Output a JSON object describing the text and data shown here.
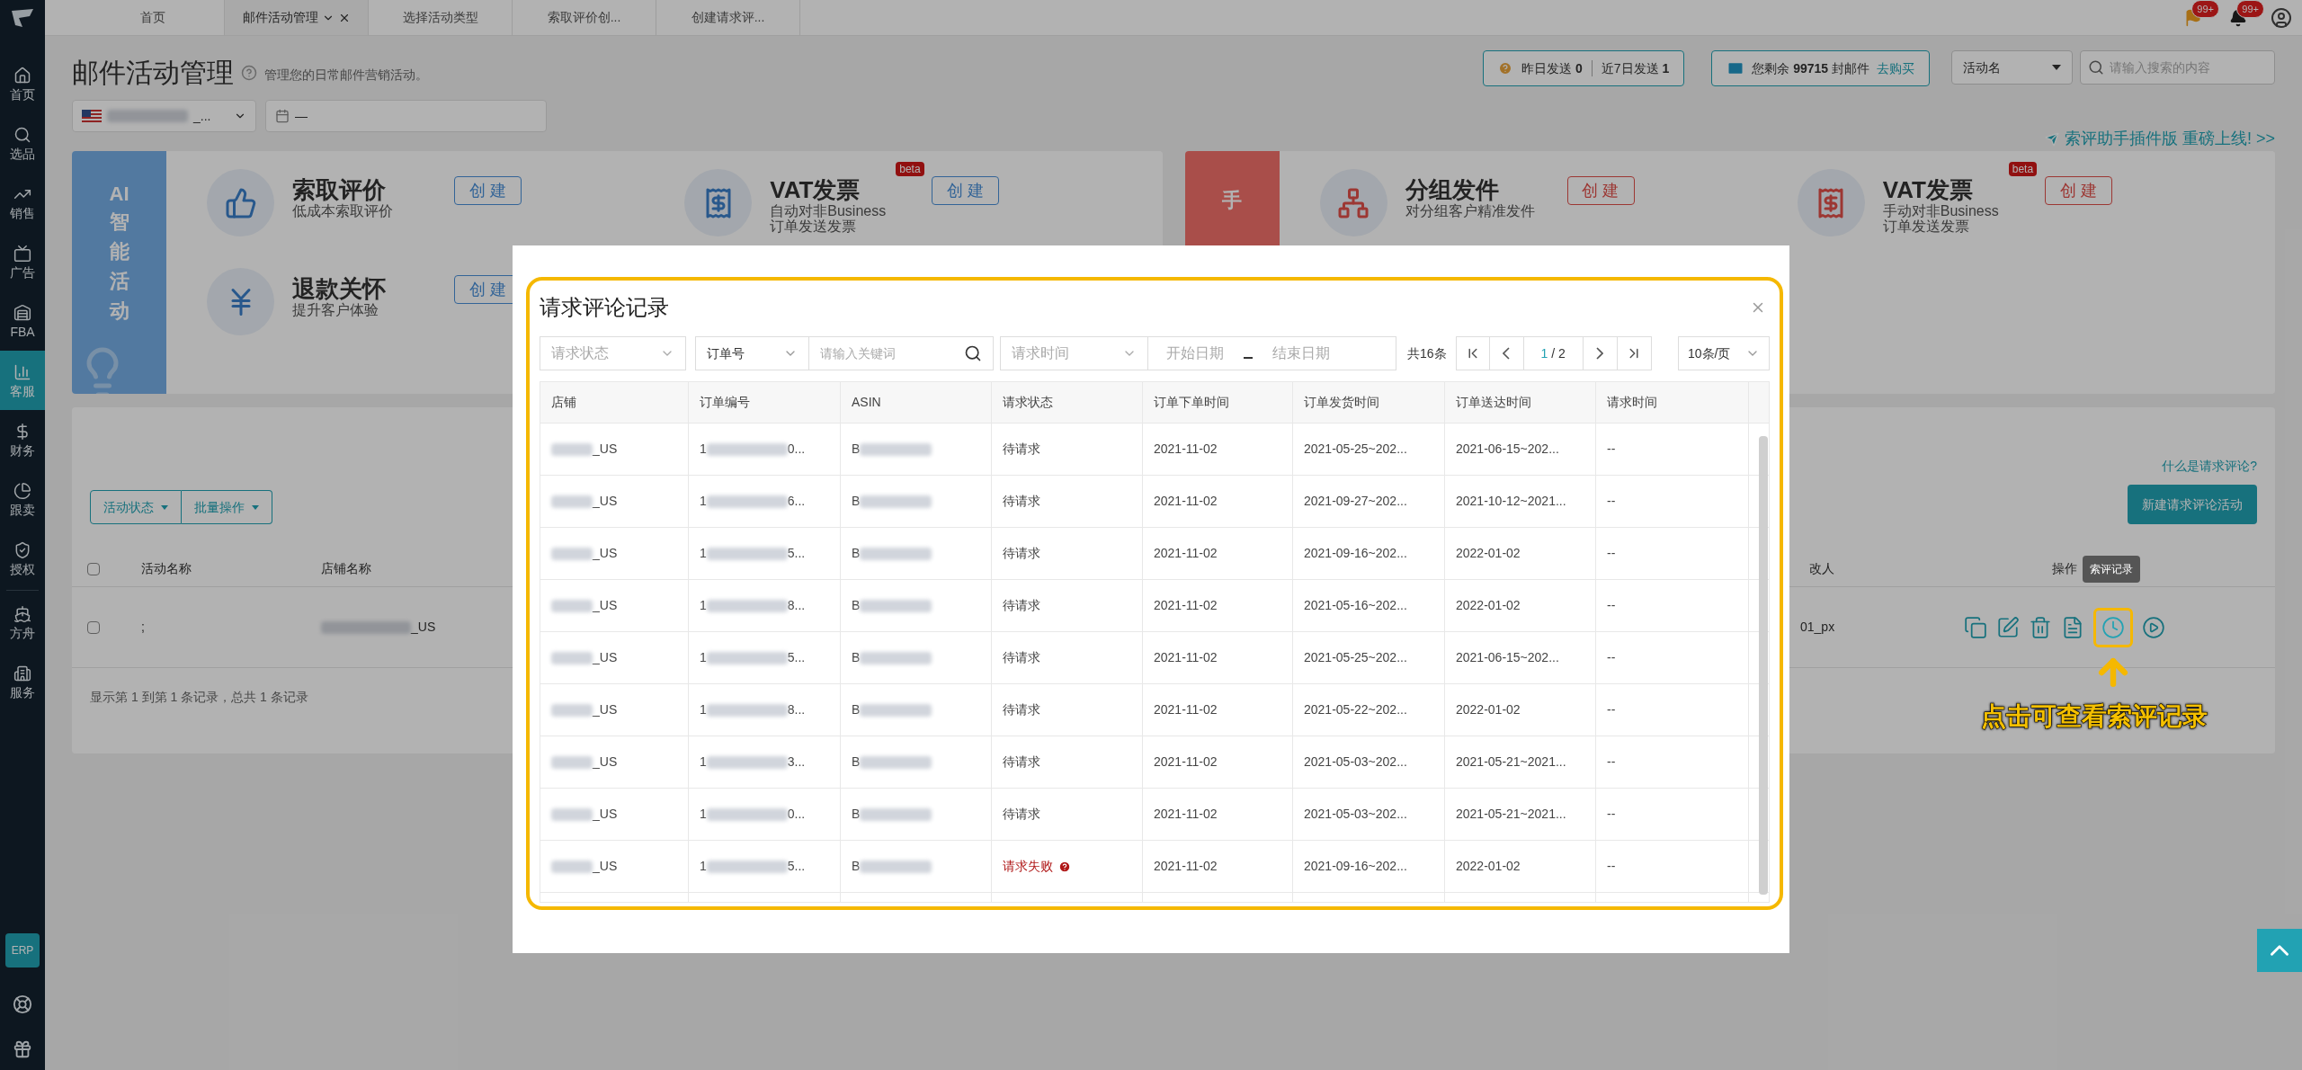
{
  "top_tabs": [
    {
      "label": "首页",
      "selected": false,
      "closable": false
    },
    {
      "label": "邮件活动管理",
      "selected": true,
      "closable": true
    },
    {
      "label": "选择活动类型",
      "selected": false,
      "closable": false
    },
    {
      "label": "索取评价创...",
      "selected": false,
      "closable": false
    },
    {
      "label": "创建请求评...",
      "selected": false,
      "closable": false
    }
  ],
  "notifications": [
    {
      "badge": "99+"
    },
    {
      "badge": "99+"
    }
  ],
  "sidebar": {
    "items": [
      {
        "label": "首页",
        "selected": false
      },
      {
        "label": "选品",
        "selected": false
      },
      {
        "label": "销售",
        "selected": false
      },
      {
        "label": "广告",
        "selected": false
      },
      {
        "label": "FBA",
        "selected": false
      },
      {
        "label": "客服",
        "selected": true
      },
      {
        "label": "财务",
        "selected": false
      },
      {
        "label": "跟卖",
        "selected": false
      },
      {
        "label": "授权",
        "selected": false
      },
      {
        "label": "方舟",
        "selected": false
      },
      {
        "label": "服务",
        "selected": false
      }
    ],
    "erp": "ERP"
  },
  "header": {
    "title": "邮件活动管理",
    "subtitle": "管理您的日常邮件营销活动。",
    "store_suffix": "_...",
    "date": "—",
    "sent_yesterday_label": "昨日发送",
    "sent_yesterday": "0",
    "sent_week_label": "近7日发送",
    "sent_week": "1",
    "remaining_prefix": "您剩余",
    "remaining": "99715",
    "remaining_suffix": "封邮件",
    "buy": "去购买",
    "search_type": "活动名",
    "search_placeholder": "请输入搜索的内容",
    "plugin_link": "索评助手插件版 重磅上线! >>"
  },
  "card_groups": [
    {
      "kind": "ai",
      "label_top": "AI",
      "label": "智能活动",
      "items": [
        {
          "title": "索取评价",
          "desc": [
            "低成本索取评价"
          ],
          "create": "创 建"
        },
        {
          "title": "VAT发票",
          "desc": [
            "自动对非Business",
            "订单发送发票"
          ],
          "beta": "beta",
          "create": "创 建"
        },
        {
          "title": "退款关怀",
          "desc": [
            "提升客户体验"
          ],
          "create": "创 建"
        }
      ]
    },
    {
      "kind": "manual",
      "label": "手",
      "items": [
        {
          "title": "分组发件",
          "desc": [
            "对分组客户精准发件"
          ],
          "create": "创 建"
        },
        {
          "title": "VAT发票",
          "desc": [
            "手动对非Business",
            "订单发送发票"
          ],
          "beta": "beta",
          "create": "创 建"
        }
      ]
    }
  ],
  "campaigns": {
    "status_button": "活动状态",
    "batch_button": "批量操作",
    "help_link": "什么是请求评论?",
    "new_button": "新建请求评论活动",
    "columns": [
      "活动名称",
      "店铺名称",
      "改人",
      "操作"
    ],
    "header_checked": false,
    "rows": [
      {
        "checked": false,
        "name": ";",
        "store_suffix": "_US",
        "modifier": "01_px"
      }
    ],
    "footer": "显示第 1 到第 1 条记录，总共 1 条记录",
    "tooltip": "索评记录",
    "annotation": "点击可查看索评记录"
  },
  "modal": {
    "title": "请求评论记录",
    "status_placeholder": "请求状态",
    "order_type": "订单号",
    "keyword_placeholder": "请输入关键词",
    "time_placeholder": "请求时间",
    "start_placeholder": "开始日期",
    "end_placeholder": "结束日期",
    "total": "共16条",
    "page": "1",
    "pages": "/ 2",
    "page_size": "10条/页",
    "columns": [
      "店铺",
      "订单编号",
      "ASIN",
      "请求状态",
      "订单下单时间",
      "订单发货时间",
      "订单送达时间",
      "请求时间"
    ],
    "rows": [
      {
        "store": "_US",
        "order_start": "1",
        "order_end": "0...",
        "asin_start": "B",
        "status": "待请求",
        "failed": false,
        "ordered": "2021-11-02",
        "shipped": "2021-05-25~202...",
        "delivered": "2021-06-15~202...",
        "requested": "--"
      },
      {
        "store": "_US",
        "order_start": "1",
        "order_end": "6...",
        "asin_start": "B",
        "status": "待请求",
        "failed": false,
        "ordered": "2021-11-02",
        "shipped": "2021-09-27~202...",
        "delivered": "2021-10-12~2021...",
        "requested": "--"
      },
      {
        "store": "_US",
        "order_start": "1",
        "order_end": "5...",
        "asin_start": "B",
        "status": "待请求",
        "failed": false,
        "ordered": "2021-11-02",
        "shipped": "2021-09-16~202...",
        "delivered": "2022-01-02",
        "requested": "--"
      },
      {
        "store": "_US",
        "order_start": "1",
        "order_end": "8...",
        "asin_start": "B",
        "status": "待请求",
        "failed": false,
        "ordered": "2021-11-02",
        "shipped": "2021-05-16~202...",
        "delivered": "2022-01-02",
        "requested": "--"
      },
      {
        "store": "_US",
        "order_start": "1",
        "order_end": "5...",
        "asin_start": "B",
        "status": "待请求",
        "failed": false,
        "ordered": "2021-11-02",
        "shipped": "2021-05-25~202...",
        "delivered": "2021-06-15~202...",
        "requested": "--"
      },
      {
        "store": "_US",
        "order_start": "1",
        "order_end": "8...",
        "asin_start": "B",
        "status": "待请求",
        "failed": false,
        "ordered": "2021-11-02",
        "shipped": "2021-05-22~202...",
        "delivered": "2022-01-02",
        "requested": "--"
      },
      {
        "store": "_US",
        "order_start": "1",
        "order_end": "3...",
        "asin_start": "B",
        "status": "待请求",
        "failed": false,
        "ordered": "2021-11-02",
        "shipped": "2021-05-03~202...",
        "delivered": "2021-05-21~2021...",
        "requested": "--"
      },
      {
        "store": "_US",
        "order_start": "1",
        "order_end": "0...",
        "asin_start": "B",
        "status": "待请求",
        "failed": false,
        "ordered": "2021-11-02",
        "shipped": "2021-05-03~202...",
        "delivered": "2021-05-21~2021...",
        "requested": "--"
      },
      {
        "store": "_US",
        "order_start": "1",
        "order_end": "5...",
        "asin_start": "B",
        "status": "请求失败",
        "failed": true,
        "ordered": "2021-11-02",
        "shipped": "2021-09-16~202...",
        "delivered": "2022-01-02",
        "requested": "--"
      }
    ]
  }
}
